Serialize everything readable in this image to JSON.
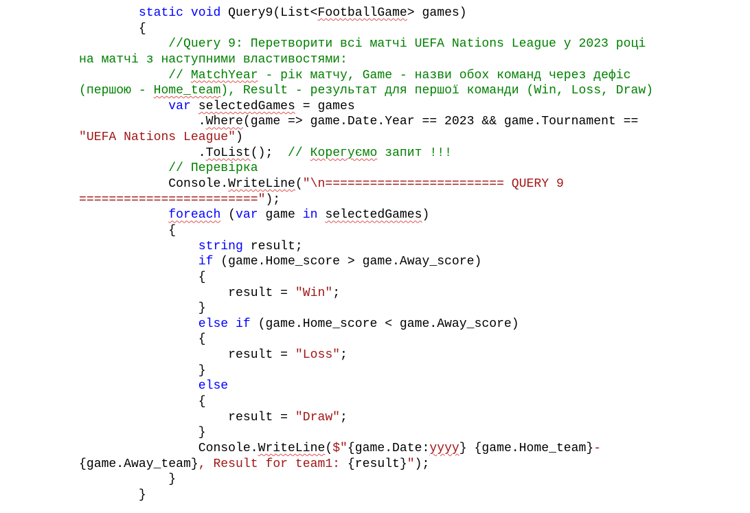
{
  "code": {
    "language": "csharp",
    "lines": [
      [
        {
          "t": "        ",
          "c": "pl"
        },
        {
          "t": "static",
          "c": "kw"
        },
        {
          "t": " ",
          "c": "pl"
        },
        {
          "t": "void",
          "c": "kw"
        },
        {
          "t": " Query9(List<",
          "c": "pl"
        },
        {
          "t": "FootballGame",
          "c": "pl",
          "u": true
        },
        {
          "t": "> games)",
          "c": "pl"
        }
      ],
      [
        {
          "t": "        {",
          "c": "pl"
        }
      ],
      [
        {
          "t": "            //Query 9: Перетворити всі матчі UEFA Nations League у 2023 році",
          "c": "cm"
        }
      ],
      [
        {
          "t": "на матчі з наступними властивостями:",
          "c": "cm"
        }
      ],
      [
        {
          "t": "            // ",
          "c": "cm"
        },
        {
          "t": "MatchYear",
          "c": "cm",
          "u": true
        },
        {
          "t": " - рік матчу, Game - назви обох команд через дефіс",
          "c": "cm"
        }
      ],
      [
        {
          "t": "(першою - ",
          "c": "cm"
        },
        {
          "t": "Home_team",
          "c": "cm",
          "u": true
        },
        {
          "t": "), Result - результат для першої команди (Win, Loss, Draw)",
          "c": "cm"
        }
      ],
      [
        {
          "t": "            ",
          "c": "pl"
        },
        {
          "t": "var",
          "c": "kw"
        },
        {
          "t": " ",
          "c": "pl"
        },
        {
          "t": "selectedGames",
          "c": "pl",
          "u": true
        },
        {
          "t": " = games",
          "c": "pl"
        }
      ],
      [
        {
          "t": "                .",
          "c": "pl"
        },
        {
          "t": "Where",
          "c": "pl",
          "u": true
        },
        {
          "t": "(game => game.Date.Year == 2023 && game.Tournament ==",
          "c": "pl"
        }
      ],
      [
        {
          "t": "\"UEFA Nations League\"",
          "c": "st"
        },
        {
          "t": ")",
          "c": "pl"
        }
      ],
      [
        {
          "t": "                .",
          "c": "pl"
        },
        {
          "t": "ToList",
          "c": "pl",
          "u": true
        },
        {
          "t": "();  ",
          "c": "pl"
        },
        {
          "t": "// ",
          "c": "cm"
        },
        {
          "t": "Корегуємо",
          "c": "cm",
          "u": true
        },
        {
          "t": " запит !!!",
          "c": "cm"
        }
      ],
      [
        {
          "t": "            // Перевірка",
          "c": "cm"
        }
      ],
      [
        {
          "t": "            Console.",
          "c": "pl"
        },
        {
          "t": "WriteLine",
          "c": "pl",
          "u": true
        },
        {
          "t": "(",
          "c": "pl"
        },
        {
          "t": "\"\\n======================== QUERY 9",
          "c": "st"
        }
      ],
      [
        {
          "t": "========================\"",
          "c": "st"
        },
        {
          "t": ");",
          "c": "pl"
        }
      ],
      [
        {
          "t": "            ",
          "c": "pl"
        },
        {
          "t": "foreach",
          "c": "kw",
          "u": true
        },
        {
          "t": " (",
          "c": "pl"
        },
        {
          "t": "var",
          "c": "kw"
        },
        {
          "t": " game ",
          "c": "pl"
        },
        {
          "t": "in",
          "c": "kw"
        },
        {
          "t": " ",
          "c": "pl"
        },
        {
          "t": "selectedGames",
          "c": "pl",
          "u": true
        },
        {
          "t": ")",
          "c": "pl"
        }
      ],
      [
        {
          "t": "            {",
          "c": "pl"
        }
      ],
      [
        {
          "t": "                ",
          "c": "pl"
        },
        {
          "t": "string",
          "c": "kw"
        },
        {
          "t": " result;",
          "c": "pl"
        }
      ],
      [
        {
          "t": "                ",
          "c": "pl"
        },
        {
          "t": "if",
          "c": "kw"
        },
        {
          "t": " (game.Home_score > game.Away_score)",
          "c": "pl"
        }
      ],
      [
        {
          "t": "                {",
          "c": "pl"
        }
      ],
      [
        {
          "t": "                    result = ",
          "c": "pl"
        },
        {
          "t": "\"Win\"",
          "c": "st"
        },
        {
          "t": ";",
          "c": "pl"
        }
      ],
      [
        {
          "t": "                }",
          "c": "pl"
        }
      ],
      [
        {
          "t": "                ",
          "c": "pl"
        },
        {
          "t": "else",
          "c": "kw"
        },
        {
          "t": " ",
          "c": "pl"
        },
        {
          "t": "if",
          "c": "kw"
        },
        {
          "t": " (game.Home_score < game.Away_score)",
          "c": "pl"
        }
      ],
      [
        {
          "t": "                {",
          "c": "pl"
        }
      ],
      [
        {
          "t": "                    result = ",
          "c": "pl"
        },
        {
          "t": "\"Loss\"",
          "c": "st"
        },
        {
          "t": ";",
          "c": "pl"
        }
      ],
      [
        {
          "t": "                }",
          "c": "pl"
        }
      ],
      [
        {
          "t": "                ",
          "c": "pl"
        },
        {
          "t": "else",
          "c": "kw"
        }
      ],
      [
        {
          "t": "                {",
          "c": "pl"
        }
      ],
      [
        {
          "t": "                    result = ",
          "c": "pl"
        },
        {
          "t": "\"Draw\"",
          "c": "st"
        },
        {
          "t": ";",
          "c": "pl"
        }
      ],
      [
        {
          "t": "                }",
          "c": "pl"
        }
      ],
      [
        {
          "t": "                Console.",
          "c": "pl"
        },
        {
          "t": "WriteLine",
          "c": "pl",
          "u": true
        },
        {
          "t": "(",
          "c": "pl"
        },
        {
          "t": "$\"",
          "c": "st"
        },
        {
          "t": "{game.Date:",
          "c": "pl"
        },
        {
          "t": "yyyy",
          "c": "st",
          "u": true
        },
        {
          "t": "}",
          "c": "pl"
        },
        {
          "t": " ",
          "c": "st"
        },
        {
          "t": "{game.Home_team}",
          "c": "pl"
        },
        {
          "t": "-",
          "c": "st"
        }
      ],
      [
        {
          "t": "{game.Away_team}",
          "c": "pl"
        },
        {
          "t": ", Result for team1: ",
          "c": "st"
        },
        {
          "t": "{result}",
          "c": "pl"
        },
        {
          "t": "\"",
          "c": "st"
        },
        {
          "t": ");",
          "c": "pl"
        }
      ],
      [
        {
          "t": "            }",
          "c": "pl"
        }
      ],
      [
        {
          "t": "        }",
          "c": "pl"
        }
      ]
    ]
  }
}
